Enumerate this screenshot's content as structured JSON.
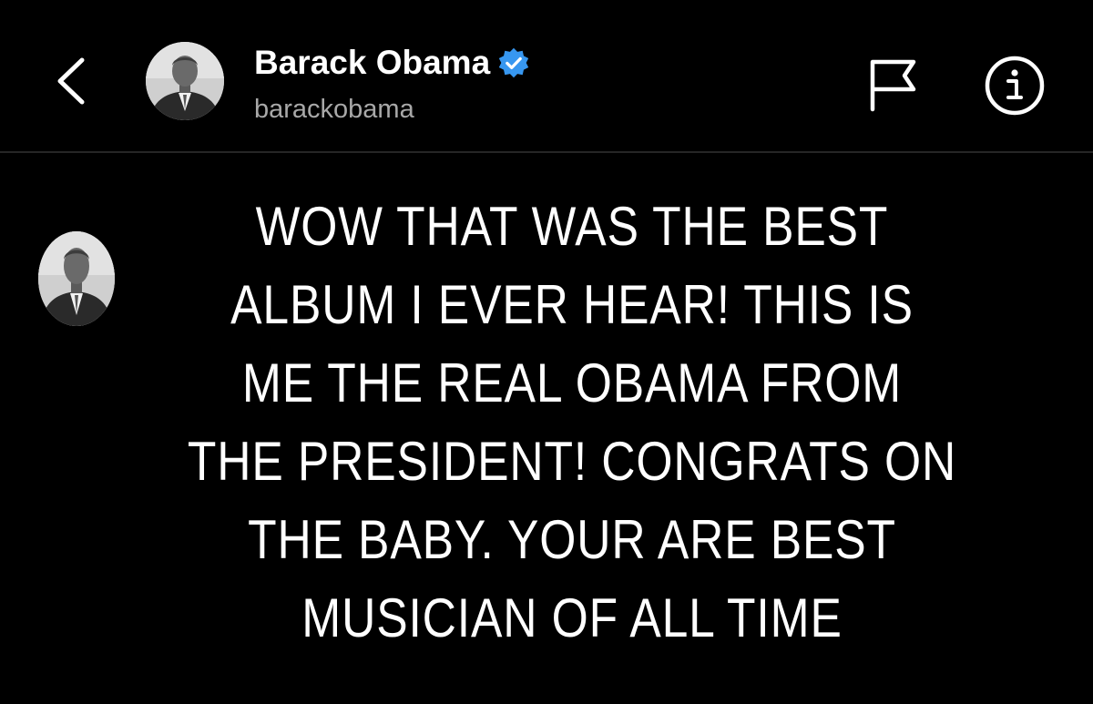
{
  "colors": {
    "background": "#000000",
    "text_primary": "#ffffff",
    "text_secondary": "#a8a8a8",
    "verified_badge": "#3797f0",
    "divider": "#262626"
  },
  "header": {
    "back_icon": "chevron-left-icon",
    "display_name": "Barack Obama",
    "verified_icon": "verified-badge-icon",
    "username": "barackobama",
    "flag_icon": "flag-icon",
    "info_icon": "info-icon"
  },
  "post": {
    "text": "WOW THAT WAS THE BEST\nALBUM I EVER HEAR! THIS IS\nME THE REAL OBAMA FROM\nTHE PRESIDENT! CONGRATS ON\nTHE BABY. YOUR ARE BEST\nMUSICIAN OF ALL TIME"
  }
}
